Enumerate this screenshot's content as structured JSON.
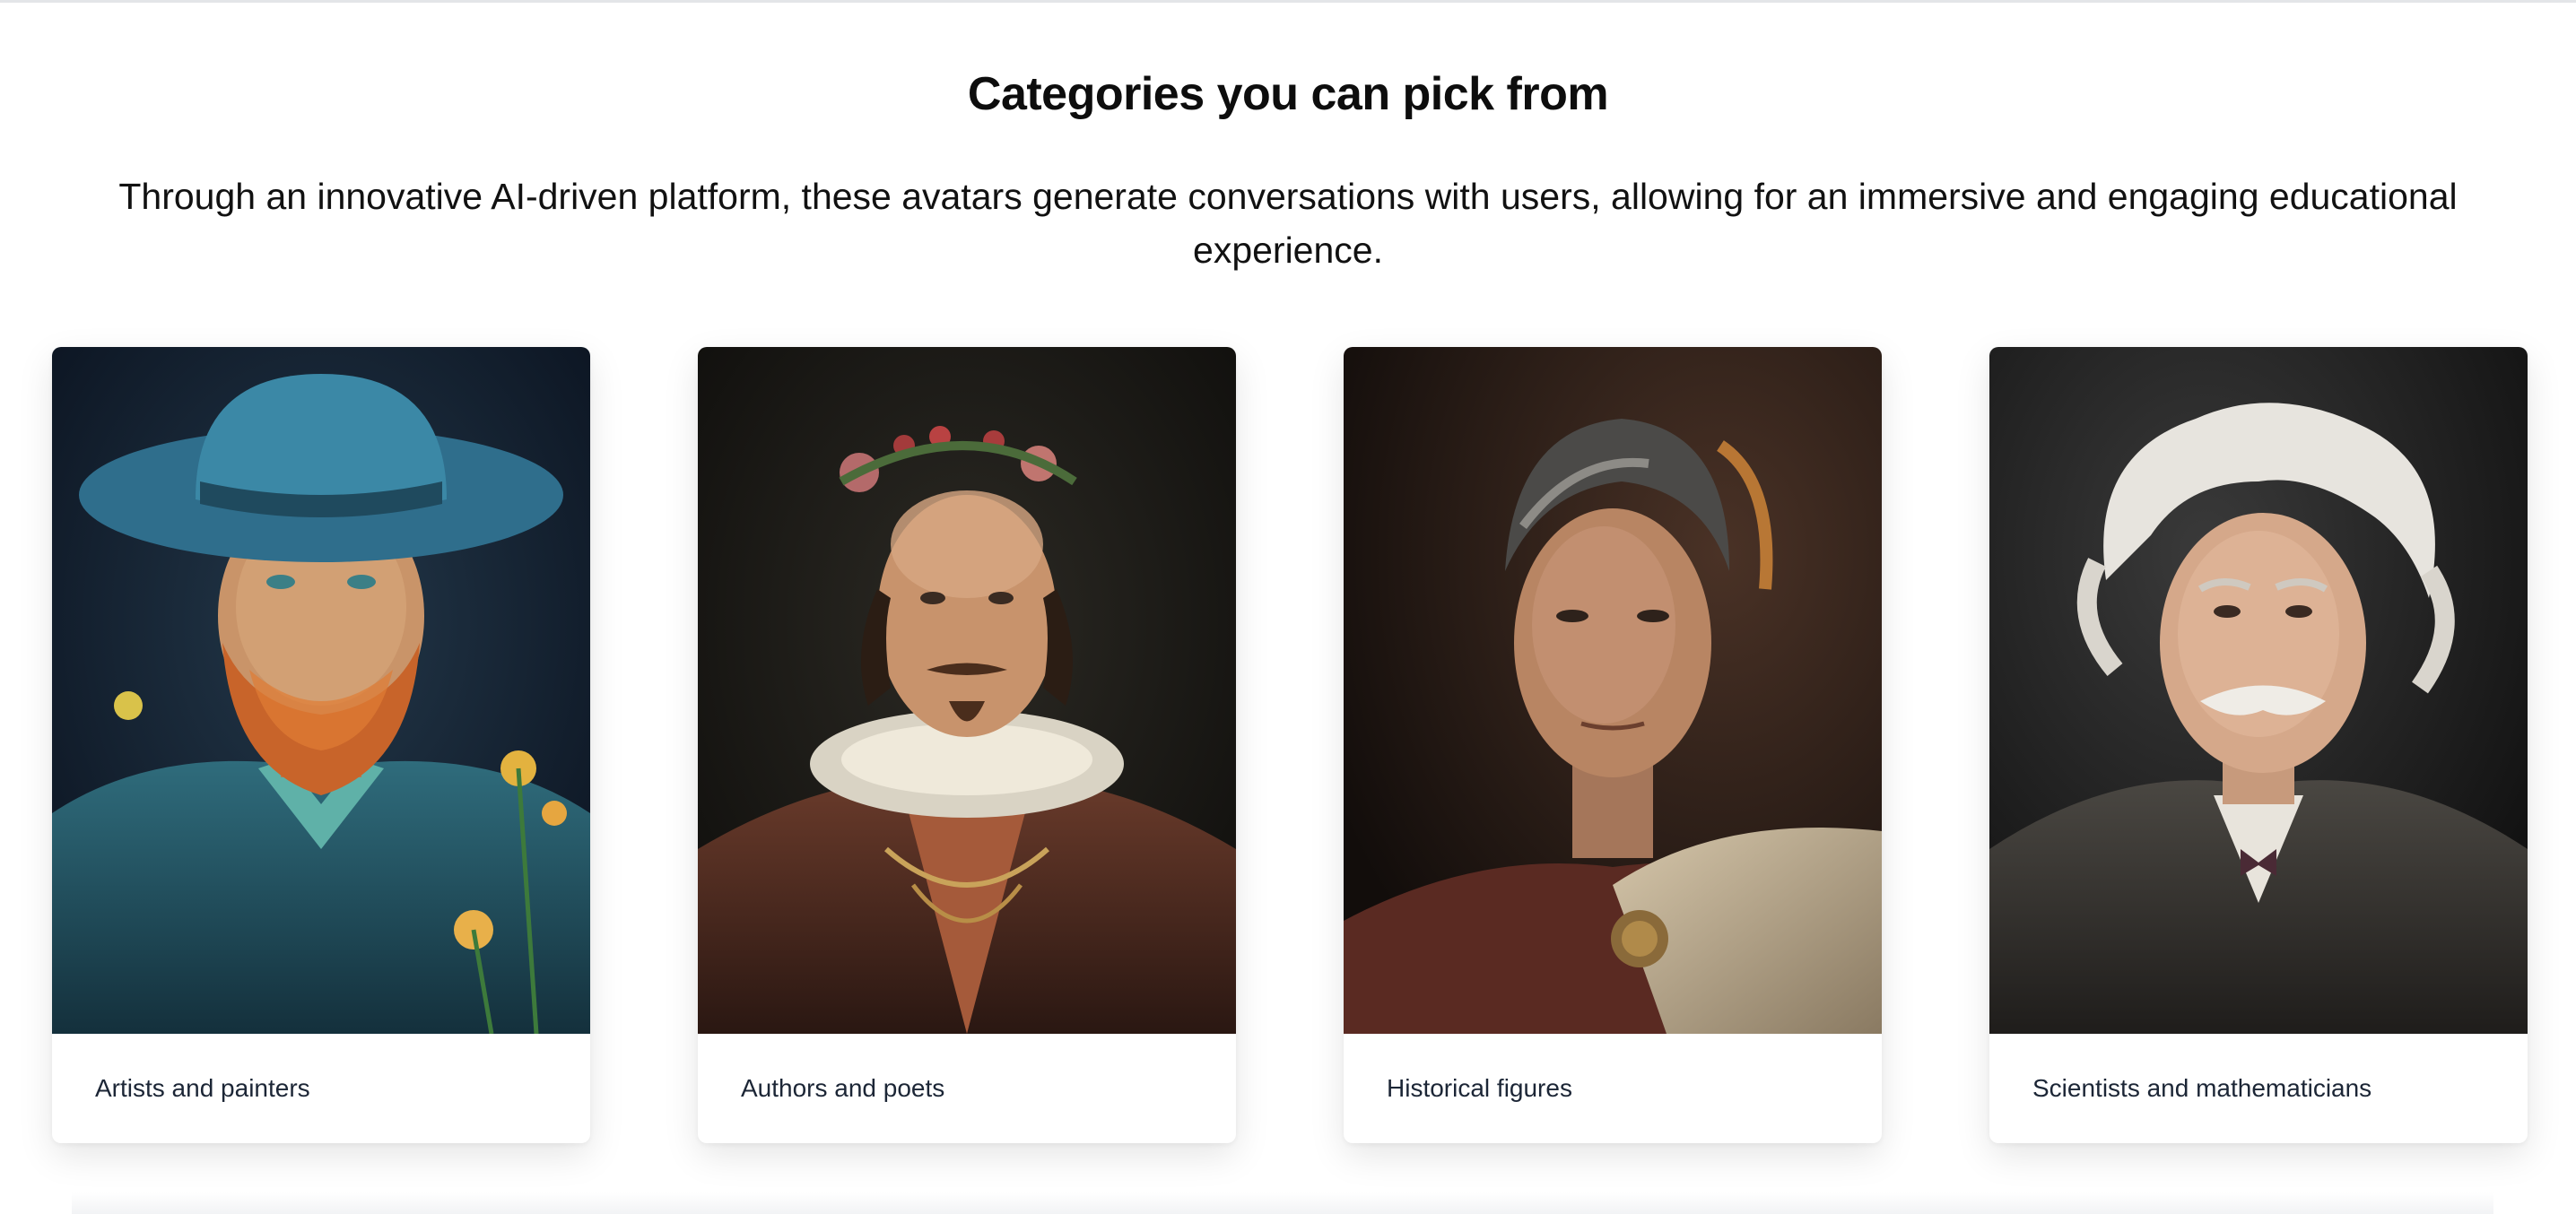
{
  "section": {
    "title": "Categories you can pick from",
    "subtitle": "Through an innovative AI-driven platform, these avatars generate conversations with users, allowing for an immersive and engaging educational experience."
  },
  "cards": [
    {
      "label": "Artists and painters",
      "image_icon": "painter-portrait",
      "accent": "#2d6f7a"
    },
    {
      "label": "Authors and poets",
      "image_icon": "poet-portrait",
      "accent": "#6b3a2a"
    },
    {
      "label": "Historical figures",
      "image_icon": "emperor-portrait",
      "accent": "#5a3a24"
    },
    {
      "label": "Scientists and mathematicians",
      "image_icon": "scientist-portrait",
      "accent": "#3a3a3a"
    }
  ]
}
